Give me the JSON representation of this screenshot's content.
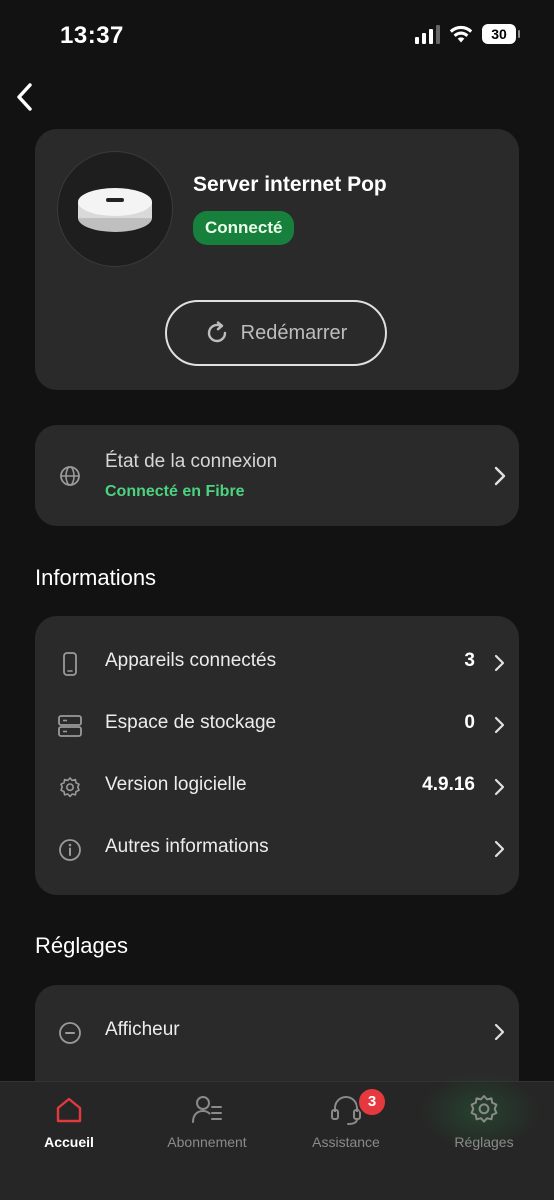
{
  "status_bar": {
    "time": "13:37",
    "battery": "30"
  },
  "device": {
    "name": "Server internet Pop",
    "status": "Connecté",
    "restart_label": "Redémarrer"
  },
  "connection": {
    "title": "État de la connexion",
    "subtitle": "Connecté en Fibre"
  },
  "informations": {
    "title": "Informations",
    "rows": [
      {
        "label": "Appareils connectés",
        "value": "3",
        "icon": "phone-icon"
      },
      {
        "label": "Espace de stockage",
        "value": "0",
        "icon": "storage-icon"
      },
      {
        "label": "Version logicielle",
        "value": "4.9.16",
        "icon": "gear-icon"
      },
      {
        "label": "Autres informations",
        "value": "",
        "icon": "info-icon"
      }
    ]
  },
  "reglages": {
    "title": "Réglages",
    "rows": [
      {
        "label": "Afficheur",
        "icon": "display-icon"
      }
    ]
  },
  "tab_bar": {
    "tabs": [
      {
        "label": "Accueil",
        "icon": "home-icon",
        "active": true
      },
      {
        "label": "Abonnement",
        "icon": "subscription-icon",
        "active": false
      },
      {
        "label": "Assistance",
        "icon": "headset-icon",
        "active": false,
        "badge": "3"
      },
      {
        "label": "Réglages",
        "icon": "gear-icon",
        "active": false
      }
    ]
  },
  "colors": {
    "background": "#121212",
    "card": "#2a2a2a",
    "accent_green": "#16803c",
    "link_green": "#4cd37f",
    "home_active": "#e03a3e",
    "badge": "#e5393f"
  }
}
